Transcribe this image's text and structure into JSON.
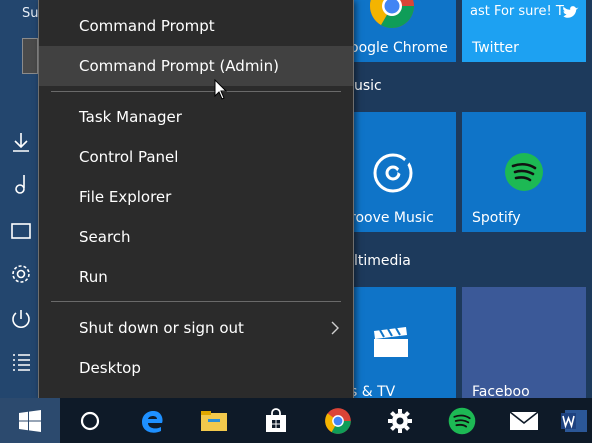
{
  "start_menu": {
    "user_name": "Su",
    "group_labels": [
      "usic",
      "ltimedia"
    ],
    "tiles": {
      "chrome_label": "oogle Chrome",
      "twitter_label": "Twitter",
      "twitter_top_text": "ast For sure! T",
      "groove_label": "roove Music",
      "spotify_label": "Spotify",
      "movies_label": "s & TV",
      "facebook_label": "Faceboo"
    }
  },
  "context_menu": {
    "items": [
      {
        "label": "Command Prompt"
      },
      {
        "label": "Command Prompt (Admin)"
      },
      {
        "label": "Task Manager"
      },
      {
        "label": "Control Panel"
      },
      {
        "label": "File Explorer"
      },
      {
        "label": "Search"
      },
      {
        "label": "Run"
      },
      {
        "label": "Shut down or sign out"
      },
      {
        "label": "Desktop"
      }
    ],
    "highlighted_item": "Command Prompt (Admin)"
  },
  "taskbar": {
    "icons": [
      "windows-start-icon",
      "cortana-icon",
      "edge-icon",
      "file-explorer-icon",
      "store-icon",
      "chrome-icon",
      "settings-icon",
      "spotify-icon",
      "mail-icon",
      "word-icon"
    ]
  },
  "colors": {
    "tile_blue": "#0f74c8",
    "menu_bg": "#2b2b2b",
    "menu_highlight": "#414141",
    "taskbar_bg": "#0e1a28",
    "spotify_green": "#1db954"
  }
}
